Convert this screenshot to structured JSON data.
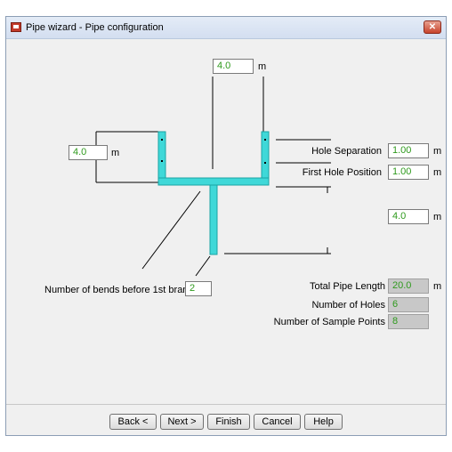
{
  "window": {
    "title": "Pipe wizard - Pipe configuration",
    "close_glyph": "✕"
  },
  "fields": {
    "top_length": {
      "value": "4.0",
      "unit": "m"
    },
    "left_length": {
      "value": "4.0",
      "unit": "m"
    },
    "right_length": {
      "value": "4.0",
      "unit": "m"
    },
    "hole_separation": {
      "label": "Hole Separation",
      "value": "1.00",
      "unit": "m"
    },
    "first_hole_position": {
      "label": "First Hole Position",
      "value": "1.00",
      "unit": "m"
    },
    "bends_before_branch": {
      "label": "Number of bends before 1st branch",
      "value": "2"
    },
    "total_pipe_length": {
      "label": "Total Pipe Length",
      "value": "20.0",
      "unit": "m"
    },
    "number_of_holes": {
      "label": "Number of Holes",
      "value": "6"
    },
    "number_of_sample_points": {
      "label": "Number of Sample Points",
      "value": "8"
    }
  },
  "buttons": {
    "back": "Back <",
    "next": "Next >",
    "finish": "Finish",
    "cancel": "Cancel",
    "help": "Help"
  },
  "colors": {
    "pipe": "#3fd8d8",
    "pipe_edge": "#1aa3a3",
    "value_text": "#2f9a1d"
  }
}
